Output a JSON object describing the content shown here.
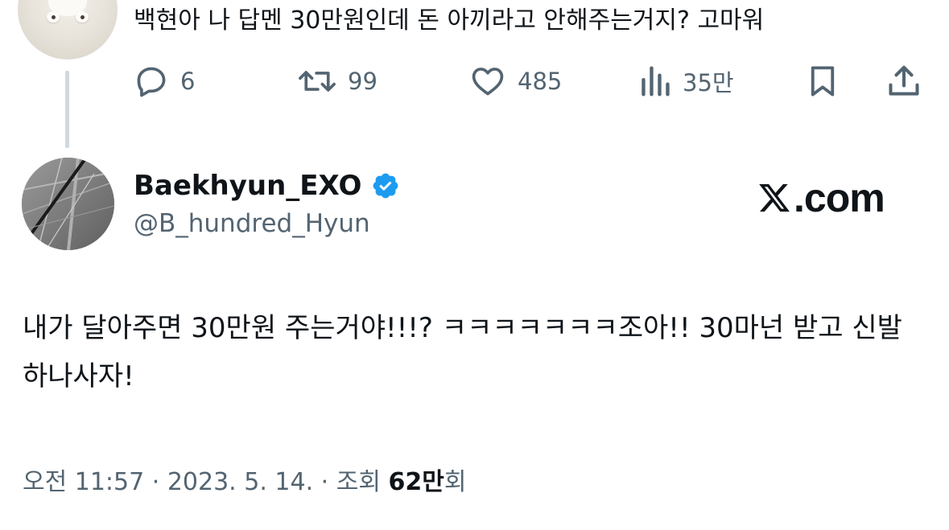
{
  "parent_tweet": {
    "text": "백현아 나 답멘 30만원인데 돈 아끼라고 안해주는거지? 고마워",
    "actions": {
      "reply": {
        "icon": "reply-icon",
        "count": "6"
      },
      "retweet": {
        "icon": "retweet-icon",
        "count": "99"
      },
      "like": {
        "icon": "heart-icon",
        "count": "485"
      },
      "views": {
        "icon": "analytics-icon",
        "count": "35만"
      },
      "bookmark": {
        "icon": "bookmark-icon"
      },
      "share": {
        "icon": "share-icon"
      }
    }
  },
  "tweet": {
    "display_name": "Baekhyun_EXO",
    "handle": "@B_hundred_Hyun",
    "verified": true,
    "body": "내가 달아주면 30만원 주는거야!!!? ㅋㅋㅋㅋㅋㅋㅋ조아!! 30마넌 받고 신발하나사자!",
    "meta": {
      "time": "오전 11:57",
      "separator": " · ",
      "date": "2023. 5. 14.",
      "views_label": "조회 ",
      "views_number": "62만",
      "views_suffix": "회"
    }
  },
  "watermark": "X.com",
  "colors": {
    "text_primary": "#0f1419",
    "text_secondary": "#536471",
    "verified_blue": "#1d9bf0",
    "thread_line": "#cfd9de"
  }
}
